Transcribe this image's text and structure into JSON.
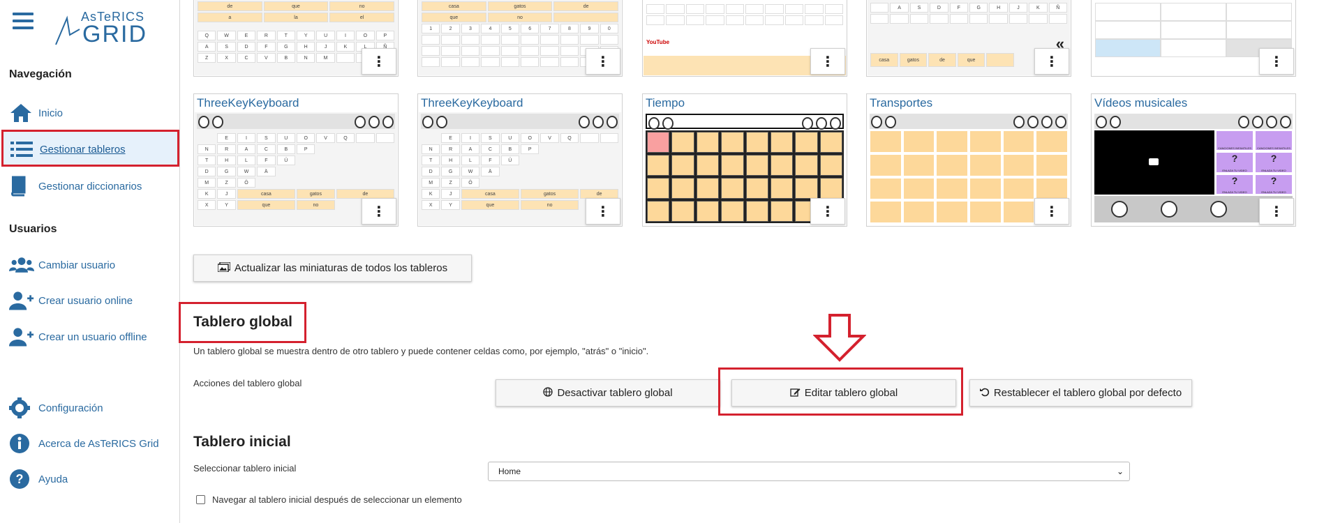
{
  "app": {
    "logo_top": "AsTeRICS",
    "logo_bottom": "GRID"
  },
  "sidebar": {
    "nav_title": "Navegación",
    "nav_items": [
      {
        "label": "Inicio",
        "icon": "home-icon"
      },
      {
        "label": "Gestionar tableros",
        "icon": "list-icon",
        "active": true
      },
      {
        "label": "Gestionar diccionarios",
        "icon": "book-icon"
      }
    ],
    "users_title": "Usuarios",
    "user_items": [
      {
        "label": "Cambiar usuario",
        "icon": "users-icon"
      },
      {
        "label": "Crear usuario online",
        "icon": "user-plus-icon"
      },
      {
        "label": "Crear un usuario offline",
        "icon": "user-plus-icon"
      }
    ],
    "bottom_items": [
      {
        "label": "Configuración",
        "icon": "gear-icon"
      },
      {
        "label": "Acerca de AsTeRICS Grid",
        "icon": "info-icon"
      },
      {
        "label": "Ayuda",
        "icon": "help-icon"
      }
    ]
  },
  "boards_row2": [
    {
      "name": "ThreeKeyKeyboard"
    },
    {
      "name": "ThreeKeyKeyboard"
    },
    {
      "name": "Tiempo"
    },
    {
      "name": "Transportes"
    },
    {
      "name": "Vídeos musicales"
    }
  ],
  "boards_row1_keys": {
    "k1_words": [
      "de",
      "que",
      "no",
      "a",
      "la",
      "el"
    ],
    "k2_words": [
      "casa",
      "gatos",
      "de",
      "que",
      "no"
    ],
    "k4_words": [
      "casa",
      "gatos",
      "de",
      "que"
    ],
    "row_qwerty": [
      "Q",
      "W",
      "E",
      "R",
      "T",
      "Y",
      "U",
      "I",
      "O",
      "P"
    ],
    "row_asdf": [
      "A",
      "S",
      "D",
      "F",
      "G",
      "H",
      "J",
      "K",
      "L",
      "Ñ"
    ],
    "row_zxcv": [
      "Z",
      "X",
      "C",
      "V",
      "B",
      "N",
      "M"
    ],
    "row_nums": [
      "1",
      "2",
      "3",
      "4",
      "5",
      "6",
      "7",
      "8",
      "9",
      "0"
    ],
    "youtube_label": "YouTube"
  },
  "three_key_keys": {
    "rows": [
      [
        "E",
        "I",
        "S",
        "U",
        "O",
        "V",
        "Q"
      ],
      [
        "N",
        "R",
        "A",
        "C",
        "B",
        "P"
      ],
      [
        "T",
        "H",
        "L",
        "F",
        "Ü"
      ],
      [
        "D",
        "G",
        "W",
        "Ä"
      ],
      [
        "M",
        "Z",
        "Ö"
      ],
      [
        "K",
        "J"
      ],
      [
        "X",
        "Y"
      ]
    ],
    "words": [
      "casa",
      "gatos",
      "de",
      "que",
      "no"
    ]
  },
  "video_board": {
    "cell_label": "ENLAZA TU VIDEO",
    "cell_label_top": "CANCIONES INFANTILES"
  },
  "actions": {
    "update_thumbnails": "Actualizar las miniaturas de todos los tableros"
  },
  "global_board": {
    "title": "Tablero global",
    "description": "Un tablero global se muestra dentro de otro tablero y puede contener celdas como, por ejemplo, \"atrás\" o \"inicio\".",
    "actions_label": "Acciones del tablero global",
    "deactivate": "Desactivar tablero global",
    "edit": "Editar tablero global",
    "reset": "Restablecer el tablero global por defecto"
  },
  "initial_board": {
    "title": "Tablero inicial",
    "select_label": "Seleccionar tablero inicial",
    "selected": "Home",
    "navigate_checkbox": "Navegar al tablero inicial después de seleccionar un elemento",
    "navigate_checked": false
  },
  "colors": {
    "accent": "#2a6aa0",
    "highlight": "#d4212e",
    "cell_yellow": "#fdd89a"
  }
}
